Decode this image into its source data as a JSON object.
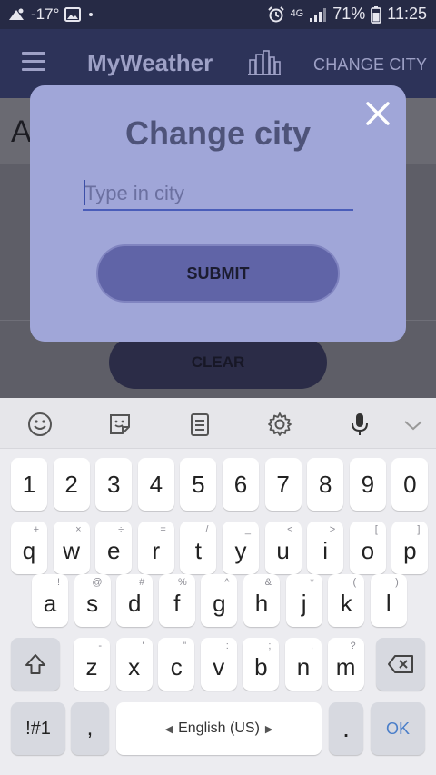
{
  "status_bar": {
    "temperature": "-17°",
    "network": "4G",
    "battery": "71%",
    "time": "11:25"
  },
  "app_bar": {
    "title": "MyWeather",
    "change_city_label": "CHANGE CITY"
  },
  "background": {
    "partial_letter": "A",
    "clear_label": "CLEAR"
  },
  "dialog": {
    "title": "Change city",
    "input_placeholder": "Type in city",
    "input_value": "",
    "submit_label": "SUBMIT"
  },
  "keyboard": {
    "number_row": [
      "1",
      "2",
      "3",
      "4",
      "5",
      "6",
      "7",
      "8",
      "9",
      "0"
    ],
    "row1": [
      {
        "key": "q",
        "hint": "+"
      },
      {
        "key": "w",
        "hint": "×"
      },
      {
        "key": "e",
        "hint": "÷"
      },
      {
        "key": "r",
        "hint": "="
      },
      {
        "key": "t",
        "hint": "/"
      },
      {
        "key": "y",
        "hint": "_"
      },
      {
        "key": "u",
        "hint": "<"
      },
      {
        "key": "i",
        "hint": ">"
      },
      {
        "key": "o",
        "hint": "["
      },
      {
        "key": "p",
        "hint": "]"
      }
    ],
    "row2": [
      {
        "key": "a",
        "hint": "!"
      },
      {
        "key": "s",
        "hint": "@"
      },
      {
        "key": "d",
        "hint": "#"
      },
      {
        "key": "f",
        "hint": "%"
      },
      {
        "key": "g",
        "hint": "^"
      },
      {
        "key": "h",
        "hint": "&"
      },
      {
        "key": "j",
        "hint": "*"
      },
      {
        "key": "k",
        "hint": "("
      },
      {
        "key": "l",
        "hint": ")"
      }
    ],
    "row3": [
      {
        "key": "z",
        "hint": "-"
      },
      {
        "key": "x",
        "hint": "'"
      },
      {
        "key": "c",
        "hint": "\""
      },
      {
        "key": "v",
        "hint": ":"
      },
      {
        "key": "b",
        "hint": ";"
      },
      {
        "key": "n",
        "hint": ","
      },
      {
        "key": "m",
        "hint": "?"
      }
    ],
    "symbols_label": "!#1",
    "comma_label": ",",
    "space_label": "English (US)",
    "period_label": ".",
    "ok_label": "OK"
  },
  "colors": {
    "app_bar": "#2d3359",
    "dialog": "#a0a6d8",
    "submit": "#6064a7",
    "input_underline": "#4a5db9"
  }
}
